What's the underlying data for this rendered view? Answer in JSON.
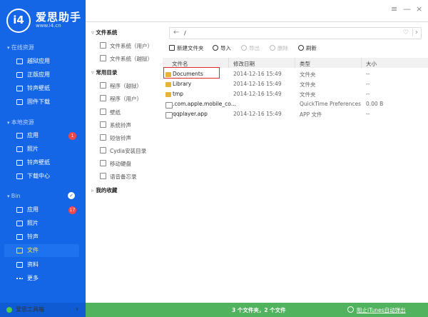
{
  "app": {
    "logo_mark": "i4",
    "name": "爱思助手",
    "url": "www.i4.cn"
  },
  "window": {
    "menu": "≡",
    "minimize": "—",
    "close": "×"
  },
  "sidebar": {
    "sections": [
      {
        "label": "在线资源",
        "items": [
          {
            "label": "越狱应用",
            "icon": "jailbreak-app-icon"
          },
          {
            "label": "正版应用",
            "icon": "app-store-icon"
          },
          {
            "label": "铃声壁纸",
            "icon": "ringtone-wallpaper-icon"
          },
          {
            "label": "固件下载",
            "icon": "firmware-icon"
          }
        ]
      },
      {
        "label": "本地资源",
        "items": [
          {
            "label": "应用",
            "badge": "1"
          },
          {
            "label": "照片"
          },
          {
            "label": "铃声壁纸"
          },
          {
            "label": "下载中心"
          }
        ]
      },
      {
        "label": "Bin",
        "items": [
          {
            "label": "应用",
            "badge": "17"
          },
          {
            "label": "照片"
          },
          {
            "label": "铃声"
          },
          {
            "label": "文件",
            "selected": true
          },
          {
            "label": "资料"
          },
          {
            "label": "更多"
          }
        ]
      }
    ],
    "toolbox": "爱思工具箱"
  },
  "tree": {
    "filesystem": {
      "label": "文件系统",
      "items": [
        "文件系统（用户）",
        "文件系统（越狱）"
      ]
    },
    "common": {
      "label": "常用目录",
      "items": [
        "程序（越狱）",
        "程序（用户）",
        "壁纸",
        "系统铃声",
        "短信铃声",
        "Cydia安装目录",
        "移动硬盘",
        "语音备忘录"
      ]
    },
    "favorites": {
      "label": "我的收藏"
    }
  },
  "address": {
    "path": "/"
  },
  "toolbar": {
    "new_folder": "新建文件夹",
    "import": "导入",
    "export": "导出",
    "delete": "删除",
    "refresh": "刷新"
  },
  "table": {
    "columns": [
      "文件名",
      "修改日期",
      "类型",
      "大小"
    ],
    "rows": [
      {
        "name": "Documents",
        "date": "2014-12-16 15:49",
        "type": "文件夹",
        "size": "--"
      },
      {
        "name": "Library",
        "date": "2014-12-16 15:49",
        "type": "文件夹",
        "size": "--"
      },
      {
        "name": "tmp",
        "date": "2014-12-16 15:49",
        "type": "文件夹",
        "size": "--"
      },
      {
        "name": ".com.apple.mobile_co...",
        "date": "",
        "type": "QuickTime Preferences",
        "size": "0.00 B"
      },
      {
        "name": "qqplayer.app",
        "date": "2014-12-16 15:49",
        "type": "APP 文件",
        "size": "--"
      }
    ]
  },
  "status": {
    "count": "3 个文件夹，2 个文件",
    "itunes": "阻止iTunes自动弹出"
  },
  "colors": {
    "sidebar": "#1466e6",
    "selected_text": "#ffe535",
    "status_bar": "#52b35f",
    "highlight": "#e02828",
    "badge": "#f04848"
  }
}
